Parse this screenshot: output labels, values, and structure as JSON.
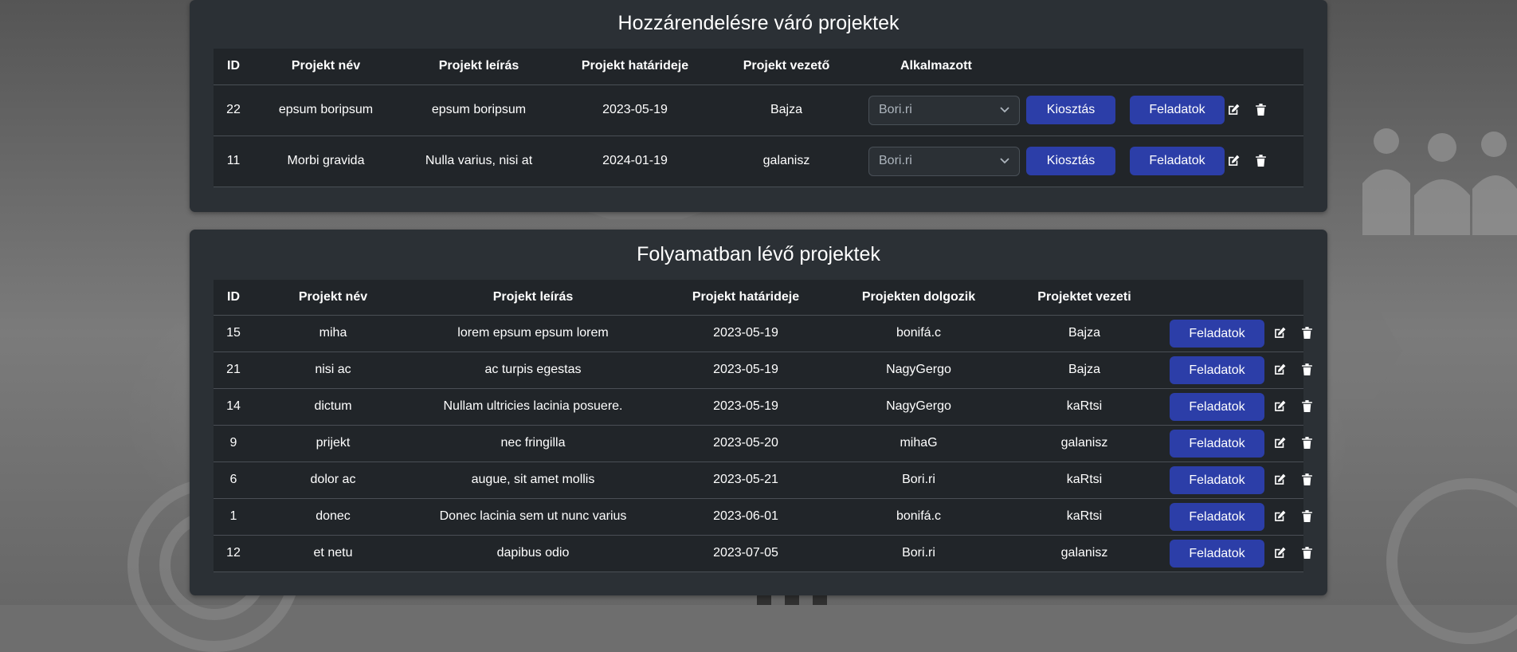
{
  "pending": {
    "title": "Hozzárendelésre váró projektek",
    "headers": [
      "ID",
      "Projekt név",
      "Projekt leírás",
      "Projekt határideje",
      "Projekt vezető",
      "Alkalmazott"
    ],
    "assign_label": "Kiosztás",
    "tasks_label": "Feladatok",
    "rows": [
      {
        "id": "22",
        "name": "epsum boripsum",
        "description": "epsum boripsum",
        "deadline": "2023-05-19",
        "leader": "Bajza",
        "employee_selected": "Bori.ri"
      },
      {
        "id": "11",
        "name": "Morbi gravida",
        "description": "Nulla varius, nisi at",
        "deadline": "2024-01-19",
        "leader": "galanisz",
        "employee_selected": "Bori.ri"
      }
    ]
  },
  "in_progress": {
    "title": "Folyamatban lévő projektek",
    "headers": [
      "ID",
      "Projekt név",
      "Projekt leírás",
      "Projekt határideje",
      "Projekten dolgozik",
      "Projektet vezeti"
    ],
    "tasks_label": "Feladatok",
    "rows": [
      {
        "id": "15",
        "name": "miha",
        "description": "lorem epsum epsum lorem",
        "deadline": "2023-05-19",
        "worker": "bonifá.c",
        "leader": "Bajza"
      },
      {
        "id": "21",
        "name": "nisi ac",
        "description": "ac turpis egestas",
        "deadline": "2023-05-19",
        "worker": "NagyGergo",
        "leader": "Bajza"
      },
      {
        "id": "14",
        "name": "dictum",
        "description": "Nullam ultricies lacinia posuere.",
        "deadline": "2023-05-19",
        "worker": "NagyGergo",
        "leader": "kaRtsi"
      },
      {
        "id": "9",
        "name": "prijekt",
        "description": "nec fringilla",
        "deadline": "2023-05-20",
        "worker": "mihaG",
        "leader": "galanisz"
      },
      {
        "id": "6",
        "name": "dolor ac",
        "description": "augue, sit amet mollis",
        "deadline": "2023-05-21",
        "worker": "Bori.ri",
        "leader": "kaRtsi"
      },
      {
        "id": "1",
        "name": "donec",
        "description": "Donec lacinia sem ut nunc varius",
        "deadline": "2023-06-01",
        "worker": "bonifá.c",
        "leader": "kaRtsi"
      },
      {
        "id": "12",
        "name": "et netu",
        "description": "dapibus odio",
        "deadline": "2023-07-05",
        "worker": "Bori.ri",
        "leader": "galanisz"
      }
    ]
  },
  "icons": {
    "edit": "edit-icon",
    "delete": "trash-icon",
    "dropdown": "chevron-down-icon"
  },
  "colors": {
    "card_bg": "#2b3035",
    "table_bg": "#212529",
    "button_primary": "#2c3ea8",
    "text": "#ffffff"
  }
}
